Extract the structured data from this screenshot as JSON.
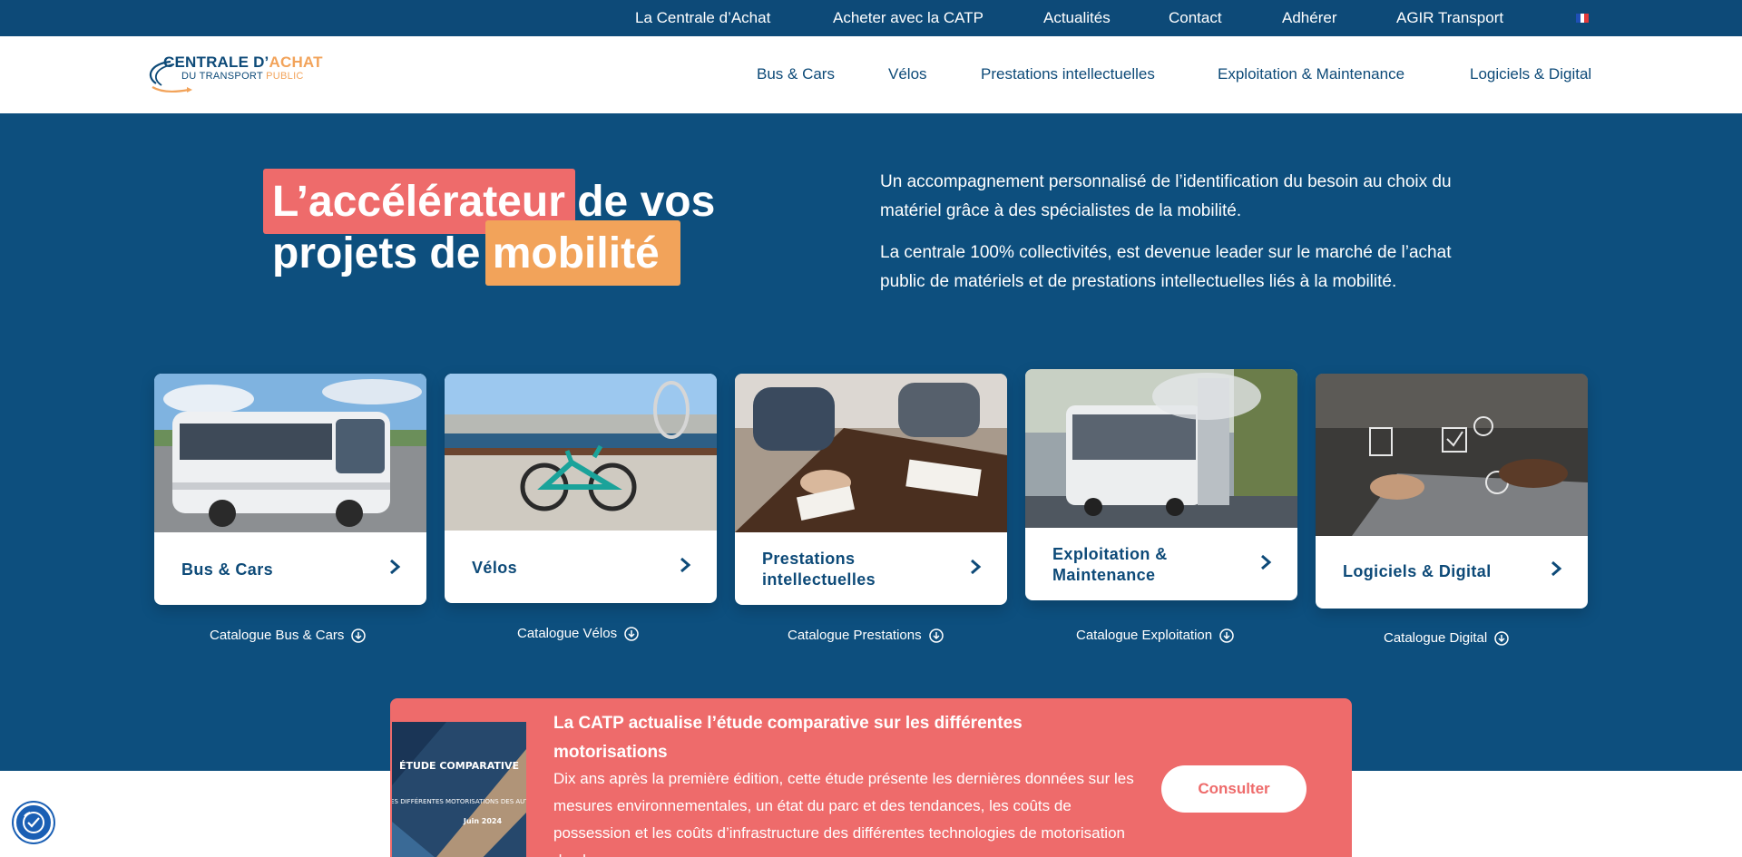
{
  "topnav": {
    "items": [
      "La Centrale d’Achat",
      "Acheter avec la CATP",
      "Actualités",
      "Contact",
      "Adhérer",
      "AGIR Transport"
    ],
    "language_flag": "french-flag-icon"
  },
  "logo": {
    "line1_main": "CENTRALE D’",
    "line1_accent": "ACHAT",
    "line2_main": "DU TRANSPORT ",
    "line2_accent": "PUBLIC"
  },
  "mainnav": {
    "items": [
      "Bus & Cars",
      "Vélos",
      "Prestations intellectuelles",
      "Exploitation & Maintenance",
      "Logiciels & Digital"
    ]
  },
  "hero": {
    "title_hl1": "L’accélérateur",
    "title_rest1": "de vos",
    "title_plain2": "projets de",
    "title_hl2": "mobilité",
    "paragraph1": "Un accompagnement personnalisé de l’identification du besoin au choix du matériel grâce à des spécialistes de la mobilité.",
    "paragraph2": "La centrale 100% collectivités, est devenue leader sur le marché de l’achat public de matériels et de prestations intellectuelles liés à la mobilité."
  },
  "cards": [
    {
      "line1": "Bus & Cars",
      "line2": "",
      "catalog": "Catalogue Bus & Cars"
    },
    {
      "line1": "Vélos",
      "line2": "",
      "catalog": "Catalogue Vélos"
    },
    {
      "line1": "Prestations",
      "line2": "intellectuelles",
      "catalog": "Catalogue Prestations"
    },
    {
      "line1": "Exploitation &",
      "line2": "Maintenance",
      "catalog": "Catalogue Exploitation"
    },
    {
      "line1": "Logiciels & Digital",
      "line2": "",
      "catalog": "Catalogue Digital"
    }
  ],
  "banner": {
    "title": "La CATP actualise l’étude comparative sur les différentes motorisations",
    "text": "Dix ans après la première édition, cette étude présente les dernières données sur les mesures environnementales, un état du parc et des tendances, les coûts de possession et les coûts d’infrastructure des différentes technologies de motorisation des bus.",
    "button": "Consulter",
    "cover_title": "ÉTUDE COMPARATIVE",
    "cover_subtitle": "SUR LES DIFFÉRENTES MOTORISATIONS DES AUTOBUS",
    "cover_date": "Juin 2024"
  },
  "colors": {
    "navy": "#0d4a78",
    "hero_bg": "#0d4f7e",
    "coral": "#ee6b6b",
    "orange": "#f2a35a"
  },
  "accessibility_button": "accessibility-icon"
}
